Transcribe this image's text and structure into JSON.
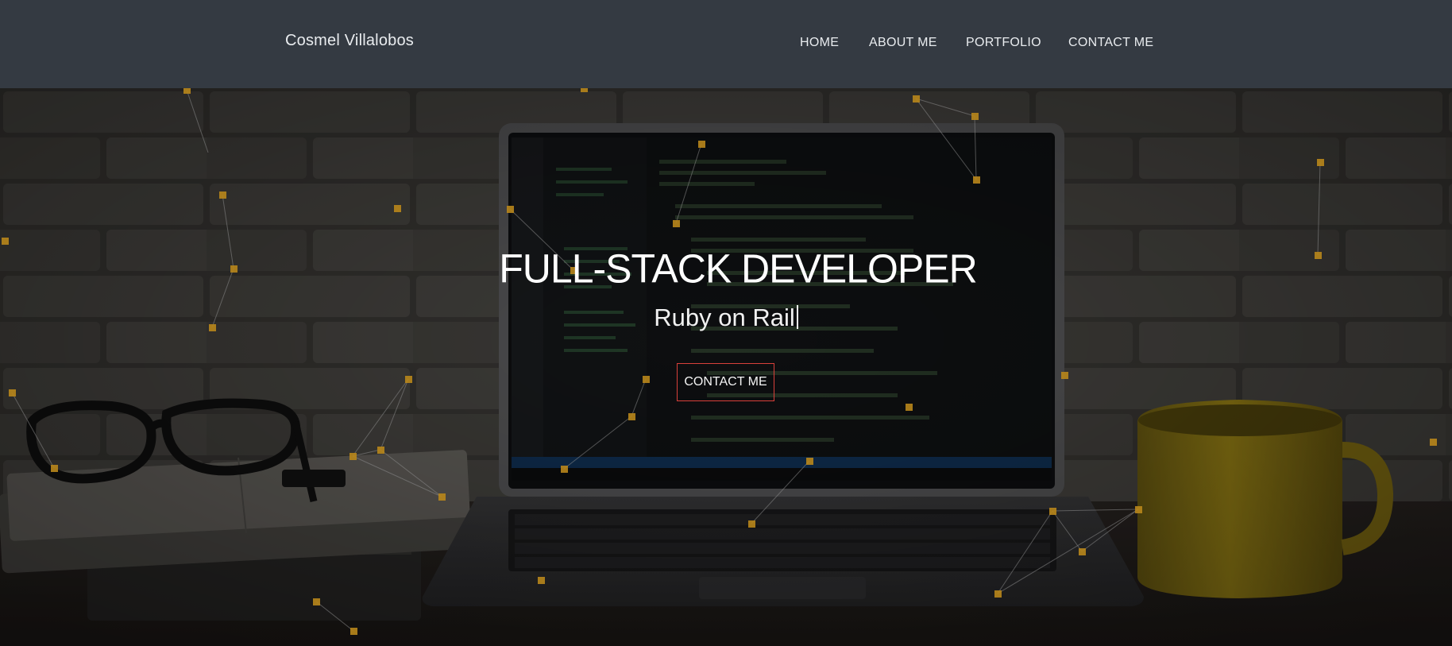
{
  "colors": {
    "navbar_bg": "#343a42",
    "nav_text": "#e9ecef",
    "accent_border": "#d9403a",
    "particle": "#b8861b"
  },
  "navbar": {
    "brand": "Cosmel Villalobos",
    "links": [
      {
        "label": "HOME"
      },
      {
        "label": "ABOUT ME"
      },
      {
        "label": "PORTFOLIO"
      },
      {
        "label": "CONTACT ME"
      }
    ]
  },
  "hero": {
    "title": "FULL-STACK DEVELOPER",
    "subtitle": "Ruby on Rail",
    "cta_label": "CONTACT ME"
  }
}
